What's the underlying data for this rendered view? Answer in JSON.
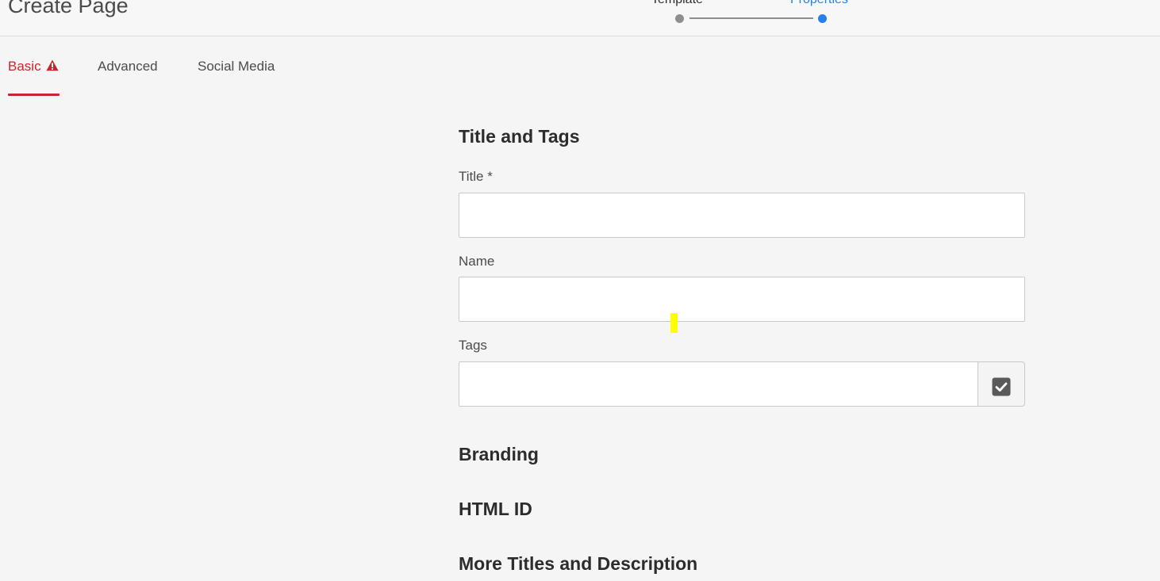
{
  "header": {
    "title": "Create Page",
    "steps": [
      {
        "label": "Template"
      },
      {
        "label": "Properties"
      }
    ]
  },
  "tabs": [
    {
      "label": "Basic",
      "active": true,
      "has_alert": true
    },
    {
      "label": "Advanced",
      "active": false
    },
    {
      "label": "Social Media",
      "active": false
    }
  ],
  "form": {
    "sections": {
      "title_and_tags": "Title and Tags",
      "branding": "Branding",
      "html_id": "HTML ID",
      "more_titles": "More Titles and Description"
    },
    "fields": {
      "title": {
        "label": "Title *",
        "value": ""
      },
      "name": {
        "label": "Name",
        "value": ""
      },
      "tags": {
        "label": "Tags",
        "value": ""
      }
    }
  },
  "icons": {
    "tab_alert": "alert-triangle-icon",
    "tags_picker": "checkbox-check-icon"
  },
  "colors": {
    "accent_red": "#c9252d",
    "step_active_blue": "#2680eb",
    "step_inactive_gray": "#8e8e8e",
    "highlight_yellow": "#ffff00"
  }
}
